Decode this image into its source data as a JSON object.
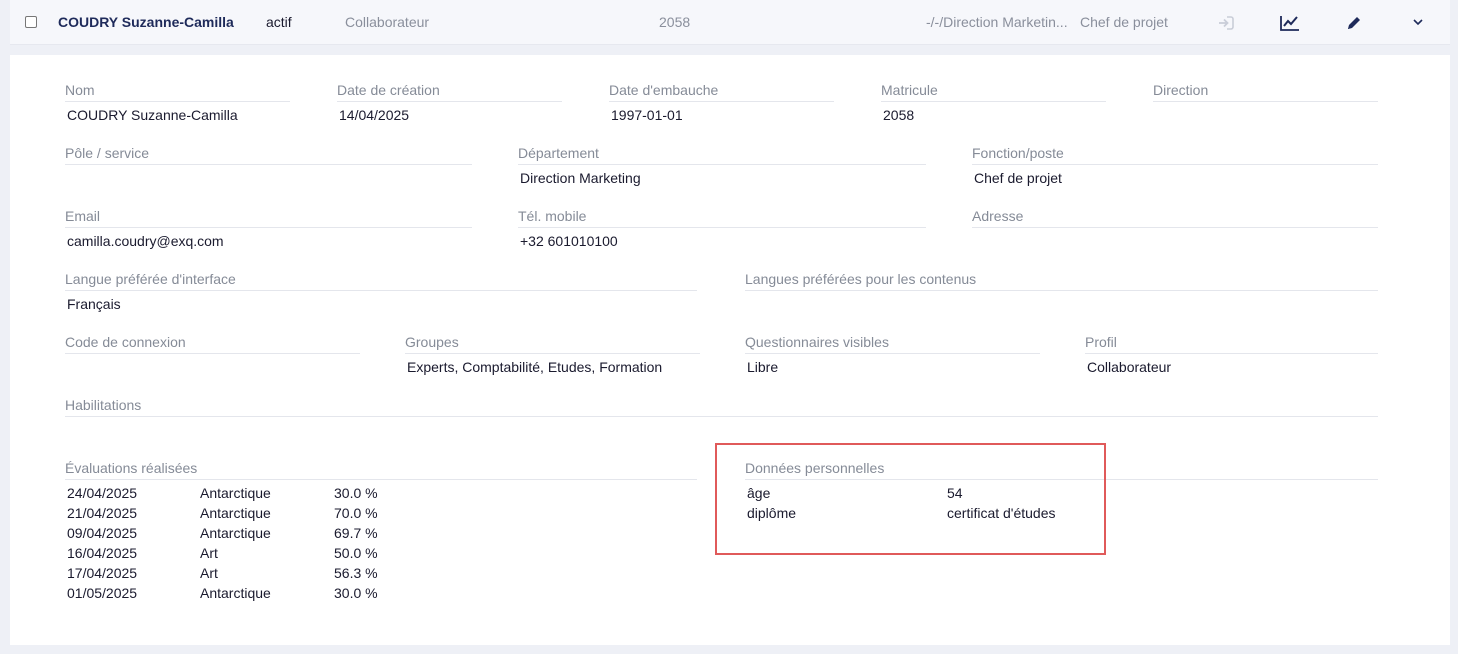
{
  "header": {
    "name": "COUDRY Suzanne-Camilla",
    "status": "actif",
    "profile": "Collaborateur",
    "matricule": "2058",
    "path": "-/-/Direction Marketin...",
    "function": "Chef de projet"
  },
  "fields": {
    "nom": {
      "label": "Nom",
      "value": "COUDRY Suzanne-Camilla"
    },
    "date_creation": {
      "label": "Date de création",
      "value": "14/04/2025"
    },
    "date_embauche": {
      "label": "Date d'embauche",
      "value": "1997-01-01"
    },
    "matricule": {
      "label": "Matricule",
      "value": "2058"
    },
    "direction": {
      "label": "Direction",
      "value": ""
    },
    "pole": {
      "label": "Pôle / service",
      "value": ""
    },
    "departement": {
      "label": "Département",
      "value": "Direction Marketing"
    },
    "fonction": {
      "label": "Fonction/poste",
      "value": "Chef de projet"
    },
    "email": {
      "label": "Email",
      "value": "camilla.coudry@exq.com"
    },
    "tel": {
      "label": "Tél. mobile",
      "value": "+32 601010100"
    },
    "adresse": {
      "label": "Adresse",
      "value": ""
    },
    "langue_interface": {
      "label": "Langue préférée d'interface",
      "value": "Français"
    },
    "langues_contenus": {
      "label": "Langues préférées pour les contenus",
      "value": ""
    },
    "code_connexion": {
      "label": "Code de connexion",
      "value": ""
    },
    "groupes": {
      "label": "Groupes",
      "value": "Experts, Comptabilité, Etudes, Formation"
    },
    "questionnaires": {
      "label": "Questionnaires visibles",
      "value": "Libre"
    },
    "profil": {
      "label": "Profil",
      "value": "Collaborateur"
    },
    "habilitations": {
      "label": "Habilitations",
      "value": ""
    }
  },
  "evaluations": {
    "label": "Évaluations réalisées",
    "rows": [
      {
        "date": "24/04/2025",
        "theme": "Antarctique",
        "score": "30.0 %"
      },
      {
        "date": "21/04/2025",
        "theme": "Antarctique",
        "score": "70.0 %"
      },
      {
        "date": "09/04/2025",
        "theme": "Antarctique",
        "score": "69.7 %"
      },
      {
        "date": "16/04/2025",
        "theme": "Art",
        "score": "50.0 %"
      },
      {
        "date": "17/04/2025",
        "theme": "Art",
        "score": "56.3 %"
      },
      {
        "date": "01/05/2025",
        "theme": "Antarctique",
        "score": "30.0 %"
      }
    ]
  },
  "personal": {
    "label": "Données personnelles",
    "rows": [
      {
        "key": "âge",
        "value": "54"
      },
      {
        "key": "diplôme",
        "value": "certificat d'études"
      }
    ]
  },
  "icons": {
    "login": "sign-in-icon",
    "stats": "chart-line-icon",
    "edit": "pencil-icon",
    "expand": "chevron-down-icon"
  },
  "colors": {
    "accent": "#1e2a5a",
    "highlight_border": "#e05a5a",
    "label": "#858b97"
  }
}
